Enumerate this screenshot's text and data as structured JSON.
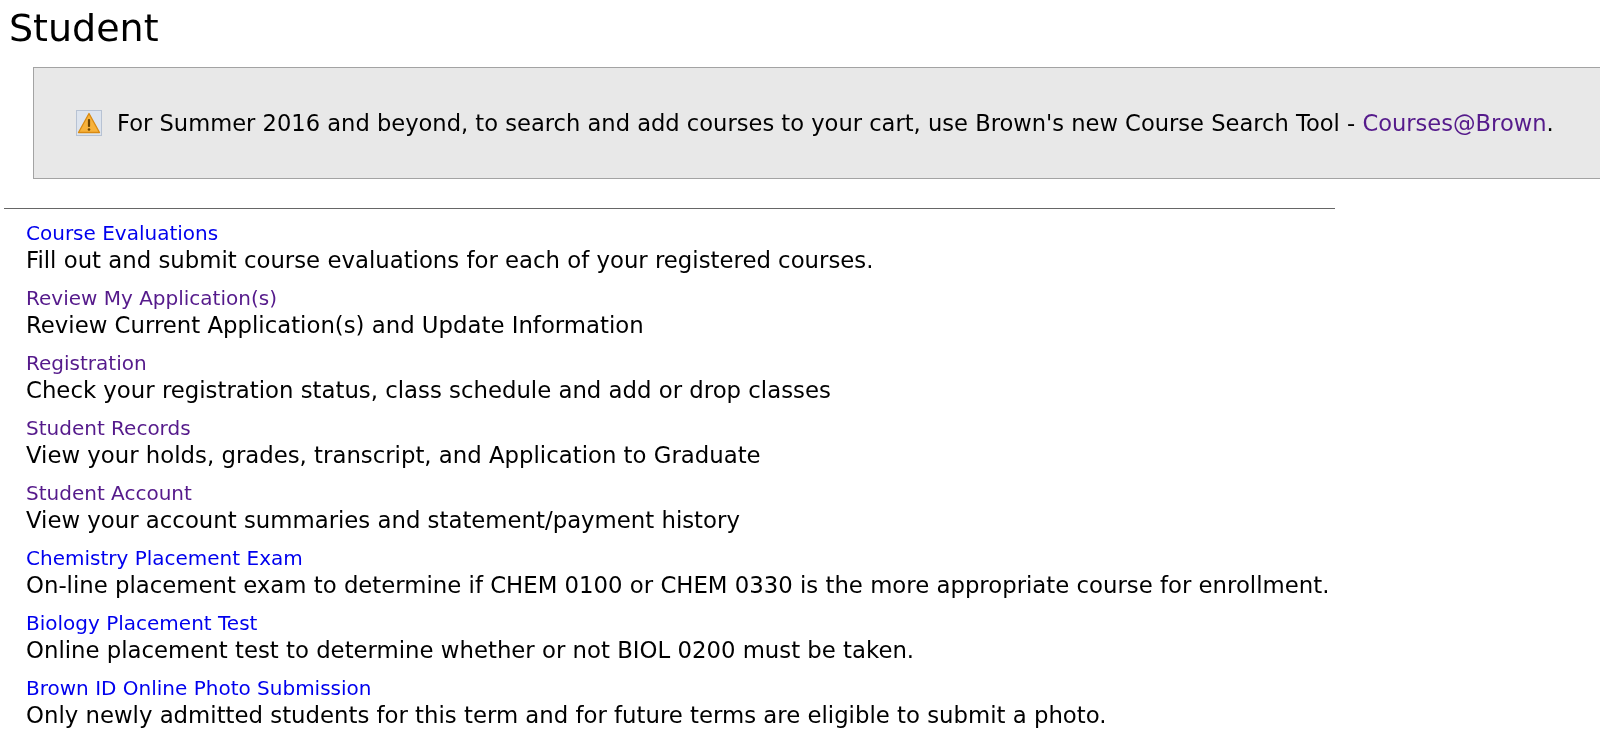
{
  "page": {
    "title": "Student"
  },
  "notice": {
    "text": "For Summer 2016 and beyond, to search and add courses to your cart, use Brown's new Course Search Tool - ",
    "link": {
      "label": "Courses@Brown",
      "visited": true
    },
    "text_after": "."
  },
  "links": [
    {
      "label": "Course Evaluations",
      "visited": false,
      "description": "Fill out and submit course evaluations for each of your registered courses."
    },
    {
      "label": "Review My Application(s)",
      "visited": true,
      "description": "Review Current Application(s) and Update Information"
    },
    {
      "label": "Registration",
      "visited": true,
      "description": "Check your registration status, class schedule and add or drop classes"
    },
    {
      "label": "Student Records",
      "visited": true,
      "description": "View your holds, grades, transcript, and Application to Graduate"
    },
    {
      "label": "Student Account",
      "visited": true,
      "description": "View your account summaries and statement/payment history"
    },
    {
      "label": "Chemistry Placement Exam",
      "visited": false,
      "description": "On-line placement exam to determine if CHEM 0100 or CHEM 0330 is the more appropriate course for enrollment."
    },
    {
      "label": "Biology Placement Test",
      "visited": false,
      "description": "Online placement test to determine whether or not BIOL 0200 must be taken."
    },
    {
      "label": "Brown ID Online Photo Submission",
      "visited": false,
      "description": "Only newly admitted students for this term and for future terms are eligible to submit a photo."
    }
  ]
}
